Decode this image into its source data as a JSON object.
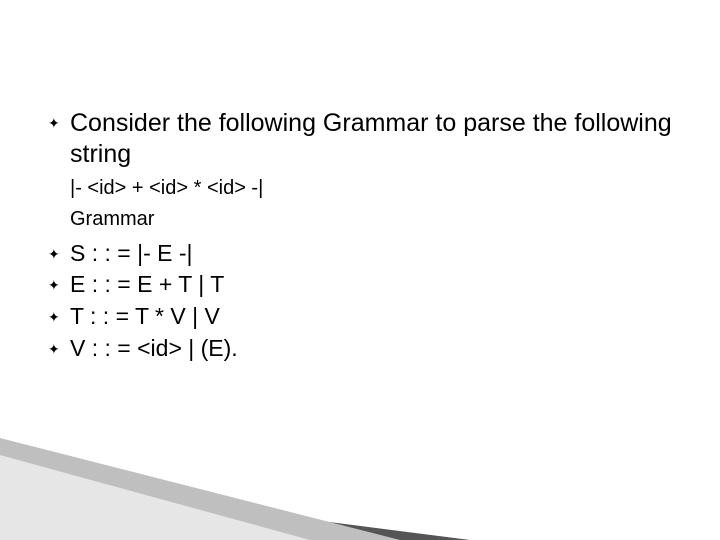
{
  "bullet_glyph": "✦",
  "lead": "Consider the following Grammar to parse the following string",
  "sub_line1": "|- <id> + <id> * <id> -|",
  "sub_line2": "Grammar",
  "rules": [
    " S : : = |- E -|",
    "E : : = E + T | T",
    "T : : = T * V | V",
    "V : : = <id> | (E)."
  ]
}
